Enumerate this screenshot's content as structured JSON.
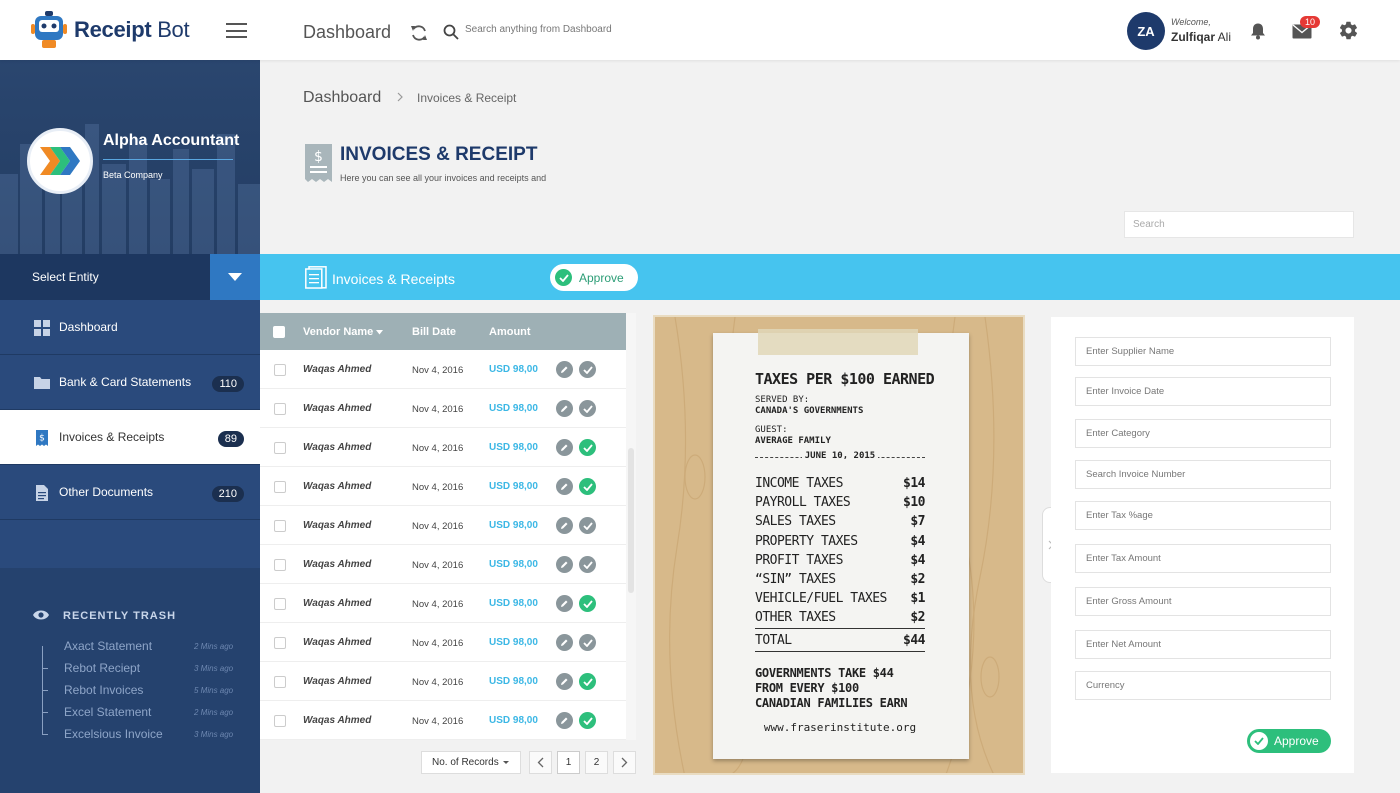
{
  "topbar": {
    "logo_text_bold": "Receipt",
    "logo_text_light": "Bot",
    "title": "Dashboard",
    "search_placeholder": "Search anything from Dashboard",
    "avatar_initials": "ZA",
    "welcome": "Welcome,",
    "user_first": "Zulfiqar",
    "user_last": "Ali",
    "mail_badge": "10"
  },
  "sidebar": {
    "company_name": "Alpha Accountant",
    "company_sub": "Beta Company",
    "select_entity": "Select Entity",
    "items": [
      {
        "label": "Dashboard",
        "badge": ""
      },
      {
        "label": "Bank & Card Statements",
        "badge": "110"
      },
      {
        "label": "Invoices & Receipts",
        "badge": "89"
      },
      {
        "label": "Other Documents",
        "badge": "210"
      }
    ],
    "trash_title": "RECENTLY TRASH",
    "trash": [
      {
        "name": "Axact Statement",
        "time": "2 Mins ago"
      },
      {
        "name": "Rebot Reciept",
        "time": "3 Mins ago"
      },
      {
        "name": "Rebot Invoices",
        "time": "5 Mins ago"
      },
      {
        "name": "Excel Statement",
        "time": "2 Mins ago"
      },
      {
        "name": "Excelsious Invoice",
        "time": "3 Mins ago"
      }
    ]
  },
  "breadcrumb": {
    "root": "Dashboard",
    "current": "Invoices & Receipt"
  },
  "page": {
    "title": "INVOICES & RECEIPT",
    "subtitle": "Here you can see all your invoices and receipts and",
    "search_placeholder": "Search"
  },
  "bluebar": {
    "title": "Invoices & Receipts",
    "approve": "Approve"
  },
  "table": {
    "headers": {
      "vendor": "Vendor Name",
      "date": "Bill Date",
      "amount": "Amount"
    },
    "rows": [
      {
        "vendor": "Waqas Ahmed",
        "date": "Nov 4, 2016",
        "amount": "USD 98,00",
        "approved": false
      },
      {
        "vendor": "Waqas Ahmed",
        "date": "Nov 4, 2016",
        "amount": "USD 98,00",
        "approved": false
      },
      {
        "vendor": "Waqas Ahmed",
        "date": "Nov 4, 2016",
        "amount": "USD 98,00",
        "approved": true
      },
      {
        "vendor": "Waqas Ahmed",
        "date": "Nov 4, 2016",
        "amount": "USD 98,00",
        "approved": true
      },
      {
        "vendor": "Waqas Ahmed",
        "date": "Nov 4, 2016",
        "amount": "USD 98,00",
        "approved": false
      },
      {
        "vendor": "Waqas Ahmed",
        "date": "Nov 4, 2016",
        "amount": "USD 98,00",
        "approved": false
      },
      {
        "vendor": "Waqas Ahmed",
        "date": "Nov 4, 2016",
        "amount": "USD 98,00",
        "approved": true
      },
      {
        "vendor": "Waqas Ahmed",
        "date": "Nov 4, 2016",
        "amount": "USD 98,00",
        "approved": false
      },
      {
        "vendor": "Waqas Ahmed",
        "date": "Nov 4, 2016",
        "amount": "USD 98,00",
        "approved": true
      },
      {
        "vendor": "Waqas Ahmed",
        "date": "Nov 4, 2016",
        "amount": "USD 98,00",
        "approved": true
      }
    ]
  },
  "pagination": {
    "records_label": "No. of Records",
    "pages": [
      "1",
      "2"
    ],
    "current": "1"
  },
  "receipt": {
    "heading_pre": "TAXES PER ",
    "heading_amount": "$100",
    "heading_post": " EARNED",
    "served_by_label": "SERVED BY:",
    "served_by": "CANADA'S GOVERNMENTS",
    "guest_label": "GUEST:",
    "guest": "AVERAGE FAMILY",
    "date": "JUNE 10, 2015",
    "lines": [
      {
        "label": "INCOME TAXES",
        "value": "$14"
      },
      {
        "label": "PAYROLL TAXES",
        "value": "$10"
      },
      {
        "label": "SALES TAXES",
        "value": "$7"
      },
      {
        "label": "PROPERTY TAXES",
        "value": "$4"
      },
      {
        "label": "PROFIT TAXES",
        "value": "$4"
      },
      {
        "label": "“SIN” TAXES",
        "value": "$2"
      },
      {
        "label": "VEHICLE/FUEL TAXES",
        "value": "$1"
      },
      {
        "label": "OTHER TAXES",
        "value": "$2"
      }
    ],
    "total_label": "TOTAL",
    "total_value": "$44",
    "footer_1": "GOVERNMENTS TAKE $44",
    "footer_2": "FROM EVERY $100",
    "footer_3": "CANADIAN FAMILIES EARN",
    "url": "www.fraserinstitute.org"
  },
  "form": {
    "fields": [
      "Enter Supplier Name",
      "Enter Invoice Date",
      "Enter Category",
      "Search Invoice Number",
      "Enter Tax %age",
      "Enter Tax Amount",
      "Enter Gross Amount",
      "Enter Net Amount",
      "Currency"
    ],
    "approve": "Approve"
  },
  "colors": {
    "navy": "#1e3a6b",
    "accent_blue": "#46c4ef",
    "green": "#2dbf7c",
    "amount": "#3bb7e5"
  }
}
